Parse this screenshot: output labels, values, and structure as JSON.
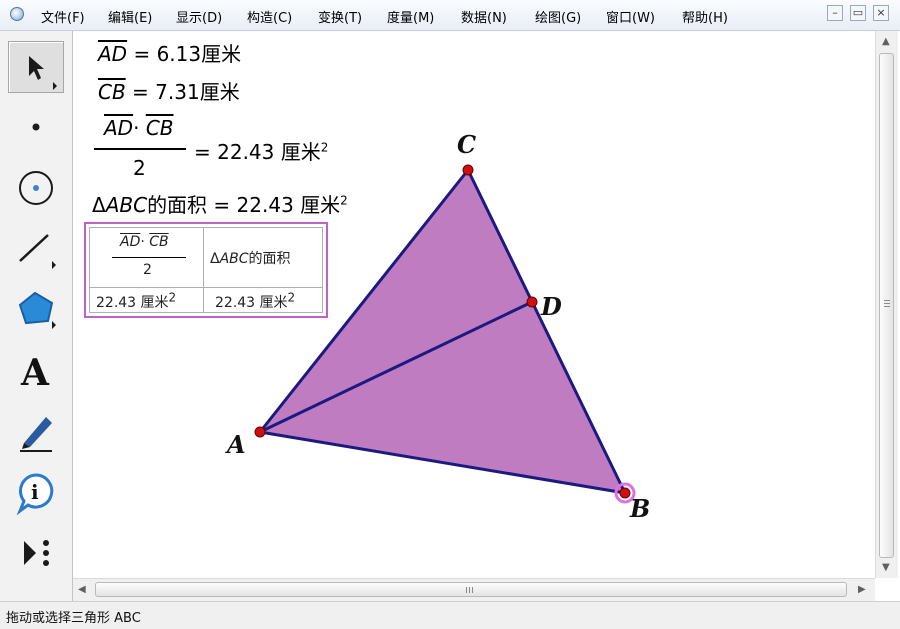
{
  "menu": {
    "items": [
      "文件(F)",
      "编辑(E)",
      "显示(D)",
      "构造(C)",
      "变换(T)",
      "度量(M)",
      "数据(N)",
      "绘图(G)",
      "窗口(W)",
      "帮助(H)"
    ]
  },
  "window_controls": [
    "–",
    "▭",
    "×"
  ],
  "toolbox": {
    "tools": [
      {
        "name": "arrow-select-tool",
        "selected": true
      },
      {
        "name": "point-tool"
      },
      {
        "name": "compass-tool"
      },
      {
        "name": "straightedge-tool"
      },
      {
        "name": "polygon-tool"
      },
      {
        "name": "text-tool",
        "glyph": "A"
      },
      {
        "name": "marker-tool"
      },
      {
        "name": "information-tool",
        "glyph": "i"
      },
      {
        "name": "custom-tool"
      }
    ]
  },
  "measurements": {
    "ad": {
      "seg": "AD",
      "rest": " = 6.13厘米"
    },
    "cb": {
      "seg": "CB",
      "rest": " = 7.31厘米"
    },
    "formula": {
      "num_a": "AD",
      "dot": "·",
      "num_b": "CB",
      "den": "2",
      "rest": "= 22.43 厘米",
      "sup": "2"
    },
    "area": {
      "delta": "Δ",
      "abc": "ABC",
      "rest": "的面积 = 22.43 厘米",
      "sup": "2"
    }
  },
  "table": {
    "header_col1": {
      "num_a": "AD",
      "dot": "·",
      "num_b": "CB",
      "den": "2"
    },
    "header_col2": {
      "delta": "Δ",
      "abc": "ABC",
      "rest": "的面积"
    },
    "row1_col1": {
      "value": "22.43 厘米",
      "sup": "2"
    },
    "row1_col2": {
      "value": "22.43 厘米",
      "sup": "2"
    }
  },
  "figure": {
    "labels": {
      "A": "A",
      "B": "B",
      "C": "C",
      "D": "D"
    },
    "fill_color": "#c07cc0",
    "edge_color": "#1a1a80",
    "point_color": "#d01010",
    "selected_point_halo": "#e070e0"
  },
  "status": {
    "text": "拖动或选择三角形 ABC"
  }
}
